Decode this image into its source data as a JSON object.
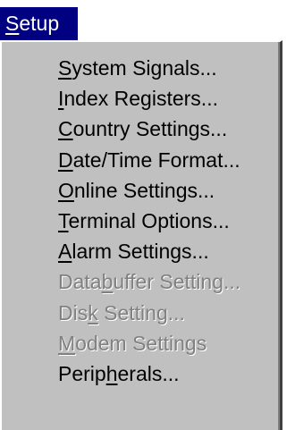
{
  "menubar": {
    "title": {
      "pre": "",
      "key": "S",
      "post": "etup"
    }
  },
  "menu": {
    "items": [
      {
        "pre": "",
        "key": "S",
        "post": "ystem Signals...",
        "enabled": true
      },
      {
        "pre": "",
        "key": "I",
        "post": "ndex Registers...",
        "enabled": true
      },
      {
        "pre": "",
        "key": "C",
        "post": "ountry Settings...",
        "enabled": true
      },
      {
        "pre": "",
        "key": "D",
        "post": "ate/Time Format...",
        "enabled": true
      },
      {
        "pre": "",
        "key": "O",
        "post": "nline Settings...",
        "enabled": true
      },
      {
        "pre": "",
        "key": "T",
        "post": "erminal Options...",
        "enabled": true
      },
      {
        "pre": "",
        "key": "A",
        "post": "larm Settings...",
        "enabled": true
      },
      {
        "pre": "Data",
        "key": "b",
        "post": "uffer Setting...",
        "enabled": false
      },
      {
        "pre": "Dis",
        "key": "k",
        "post": " Setting...",
        "enabled": false
      },
      {
        "pre": "",
        "key": "M",
        "post": "odem Settings",
        "enabled": false
      },
      {
        "pre": "Perip",
        "key": "h",
        "post": "erals...",
        "enabled": true
      }
    ]
  },
  "colors": {
    "menubar_highlight": "#000080",
    "menu_background": "#c0c0c0",
    "disabled_text": "#808080"
  }
}
